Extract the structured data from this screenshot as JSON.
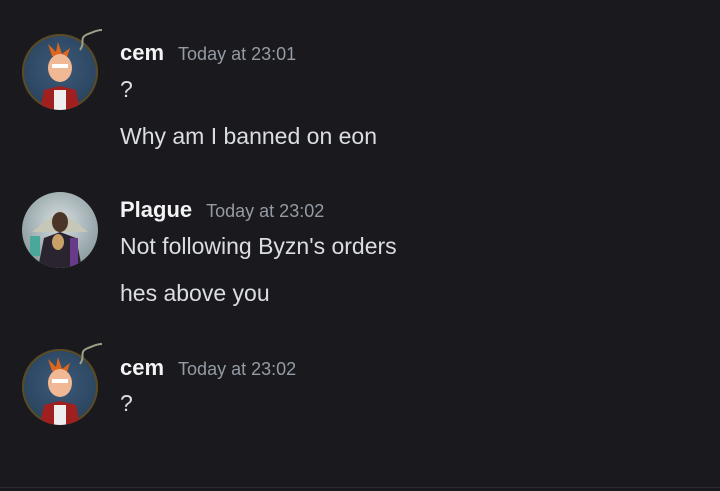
{
  "messages": [
    {
      "author": "cem",
      "timestamp": "Today at 23:01",
      "lines": [
        "?",
        "Why am I banned on eon"
      ],
      "avatar": "fry-avatar"
    },
    {
      "author": "Plague",
      "timestamp": "Today at 23:02",
      "lines": [
        "Not following Byzn's orders",
        "hes above you"
      ],
      "avatar": "plague-avatar"
    },
    {
      "author": "cem",
      "timestamp": "Today at 23:02",
      "lines": [
        "?"
      ],
      "avatar": "fry-avatar"
    }
  ],
  "colors": {
    "background": "#1a1a1e",
    "username": "#f2f3f5",
    "timestamp": "#949ba4",
    "text": "#dbdee1"
  }
}
